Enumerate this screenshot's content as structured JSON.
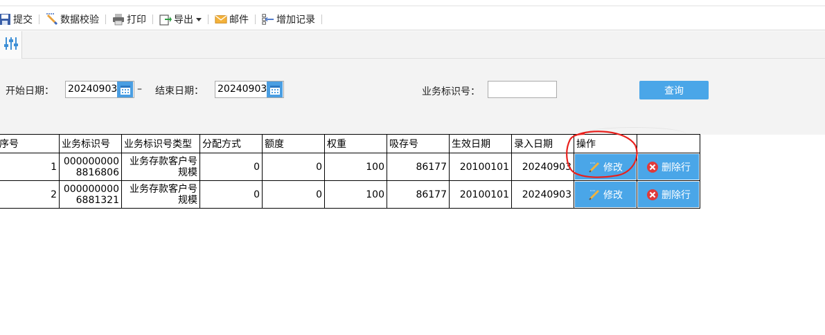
{
  "toolbar": {
    "items": [
      {
        "label": "提交",
        "icon": "save-icon"
      },
      {
        "label": "数据校验",
        "icon": "validate-icon"
      },
      {
        "label": "打印",
        "icon": "printer-icon"
      },
      {
        "label": "导出",
        "icon": "export-icon"
      },
      {
        "label": "邮件",
        "icon": "mail-icon"
      },
      {
        "label": "增加记录",
        "icon": "add-record-icon"
      }
    ]
  },
  "filter_tab": {
    "icon": "filter-sliders-icon"
  },
  "query": {
    "start_label": "开始日期：",
    "start_value": "20240903",
    "dash": "–",
    "end_label": "结束日期：",
    "end_value": "20240903",
    "biz_id_label": "业务标识号：",
    "biz_id_value": "",
    "search_label": "查询"
  },
  "table": {
    "columns": [
      "序号",
      "业务标识号",
      "业务标识号类型",
      "分配方式",
      "额度",
      "权重",
      "吸存号",
      "生效日期",
      "录入日期",
      "操作"
    ],
    "rows": [
      {
        "seq": "1",
        "biz_id": "0000000008816806",
        "biz_type": "业务存款客户号规模",
        "alloc": "0",
        "quota": "0",
        "weight": "100",
        "deposit_no": "86177",
        "effective": "20100101",
        "entry": "20240903"
      },
      {
        "seq": "2",
        "biz_id": "0000000006881321",
        "biz_type": "业务存款客户号规模",
        "alloc": "0",
        "quota": "0",
        "weight": "100",
        "deposit_no": "86177",
        "effective": "20100101",
        "entry": "20240903"
      }
    ],
    "edit_label": "修改",
    "delete_label": "删除行"
  },
  "colors": {
    "accent": "#4aa6e8",
    "annotation": "#e8211d",
    "delete_icon": "#e03a3a"
  }
}
